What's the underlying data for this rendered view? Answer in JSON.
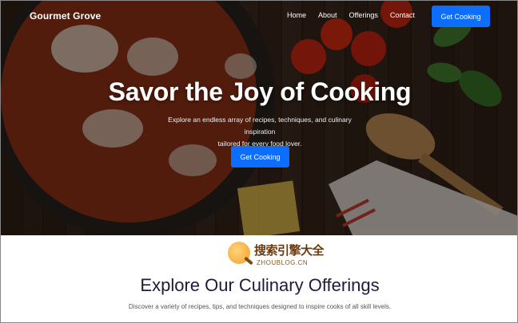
{
  "nav": {
    "brand": "Gourmet Grove",
    "links": [
      "Home",
      "About",
      "Offerings",
      "Contact"
    ],
    "cta_label": "Get Cooking"
  },
  "hero": {
    "title": "Savor the Joy of Cooking",
    "subtitle_line1": "Explore an endless array of recipes, techniques, and culinary inspiration",
    "subtitle_line2": "tailored for every food lover.",
    "cta_label": "Get Cooking"
  },
  "watermark": {
    "text_cn": "搜索引擎大全",
    "text_en": "ZHOUBLOG.CN"
  },
  "offerings": {
    "title": "Explore Our Culinary Offerings",
    "subtitle": "Discover a variety of recipes, tips, and techniques designed to inspire cooks of all skill levels."
  },
  "colors": {
    "accent": "#0d6efd",
    "heading": "#1b1d3a"
  }
}
